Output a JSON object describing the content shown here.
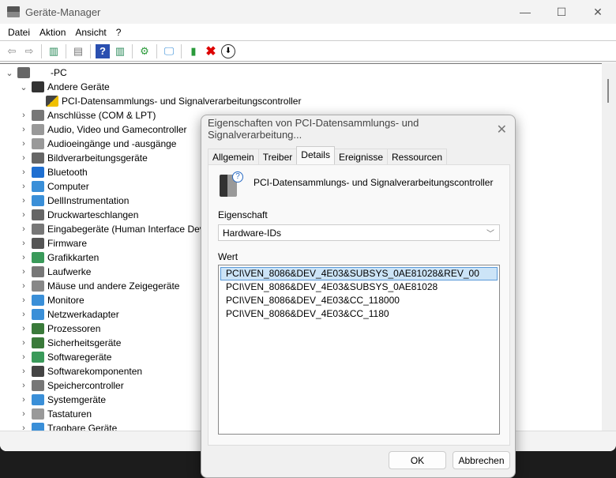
{
  "window": {
    "title": "Geräte-Manager",
    "minimize": "—",
    "maximize": "☐",
    "close": "✕"
  },
  "menu": [
    "Datei",
    "Aktion",
    "Ansicht",
    "?"
  ],
  "toolbar": [
    "back-icon",
    "forward-icon",
    "show-hide-console-tree-icon",
    "properties-icon",
    "help-icon",
    "action-pane-icon",
    "update-driver-icon",
    "scan-hardware-icon",
    "enable-device-icon",
    "uninstall-icon",
    "disable-device-icon"
  ],
  "tree": {
    "root": "-PC",
    "other": "Andere Geräte",
    "other_child": "PCI-Datensammlungs- und Signalverarbeitungscontroller",
    "categories": [
      {
        "label": "Anschlüsse (COM & LPT)",
        "color": "#777"
      },
      {
        "label": "Audio, Video und Gamecontroller",
        "color": "#999"
      },
      {
        "label": "Audioeingänge und -ausgänge",
        "color": "#999"
      },
      {
        "label": "Bildverarbeitungsgeräte",
        "color": "#666"
      },
      {
        "label": "Bluetooth",
        "color": "#1f6fd1"
      },
      {
        "label": "Computer",
        "color": "#3a8fd8"
      },
      {
        "label": "DellInstrumentation",
        "color": "#3a8fd8"
      },
      {
        "label": "Druckwarteschlangen",
        "color": "#666"
      },
      {
        "label": "Eingabegeräte (Human Interface Devices)",
        "color": "#777"
      },
      {
        "label": "Firmware",
        "color": "#555"
      },
      {
        "label": "Grafikkarten",
        "color": "#3a9a5a"
      },
      {
        "label": "Laufwerke",
        "color": "#777"
      },
      {
        "label": "Mäuse und andere Zeigegeräte",
        "color": "#888"
      },
      {
        "label": "Monitore",
        "color": "#3a8fd8"
      },
      {
        "label": "Netzwerkadapter",
        "color": "#3a8fd8"
      },
      {
        "label": "Prozessoren",
        "color": "#3a7a3a"
      },
      {
        "label": "Sicherheitsgeräte",
        "color": "#3a7a3a"
      },
      {
        "label": "Softwaregeräte",
        "color": "#3a9a5a"
      },
      {
        "label": "Softwarekomponenten",
        "color": "#444"
      },
      {
        "label": "Speichercontroller",
        "color": "#777"
      },
      {
        "label": "Systemgeräte",
        "color": "#3a8fd8"
      },
      {
        "label": "Tastaturen",
        "color": "#999"
      },
      {
        "label": "Tragbare Geräte",
        "color": "#3a8fd8"
      }
    ]
  },
  "dialog": {
    "title": "Eigenschaften von PCI-Datensammlungs- und Signalverarbeitung...",
    "close": "✕",
    "tabs": [
      "Allgemein",
      "Treiber",
      "Details",
      "Ereignisse",
      "Ressourcen"
    ],
    "active_tab": "Details",
    "device_name": "PCI-Datensammlungs- und Signalverarbeitungscontroller",
    "property_label": "Eigenschaft",
    "property_value": "Hardware-IDs",
    "value_label": "Wert",
    "values": [
      "PCI\\VEN_8086&DEV_4E03&SUBSYS_0AE81028&REV_00",
      "PCI\\VEN_8086&DEV_4E03&SUBSYS_0AE81028",
      "PCI\\VEN_8086&DEV_4E03&CC_118000",
      "PCI\\VEN_8086&DEV_4E03&CC_1180"
    ],
    "ok": "OK",
    "cancel": "Abbrechen"
  }
}
